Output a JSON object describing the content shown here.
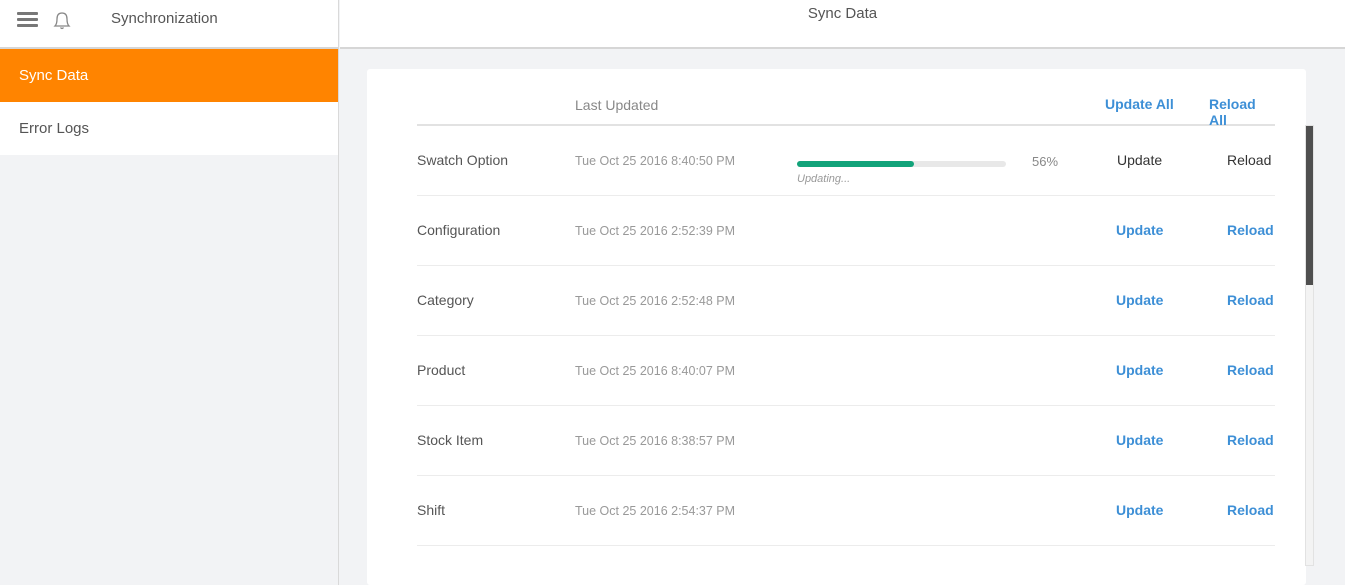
{
  "sidebar": {
    "title": "Synchronization",
    "icons": {
      "menu": "hamburger-menu-icon",
      "notifications": "bell-icon"
    },
    "items": [
      {
        "label": "Sync Data",
        "active": true
      },
      {
        "label": "Error Logs",
        "active": false
      }
    ]
  },
  "header": {
    "title": "Sync Data"
  },
  "table": {
    "column_last_updated": "Last Updated",
    "update_all_label": "Update All",
    "reload_all_label": "Reload All",
    "rows": [
      {
        "name": "Swatch Option",
        "last_updated": "Tue Oct 25 2016 8:40:50 PM",
        "update_label": "Update",
        "reload_label": "Reload",
        "syncing": true,
        "progress_percent": 56,
        "progress_text": "56%",
        "status_text": "Updating..."
      },
      {
        "name": "Configuration",
        "last_updated": "Tue Oct 25 2016 2:52:39 PM",
        "update_label": "Update",
        "reload_label": "Reload"
      },
      {
        "name": "Category",
        "last_updated": "Tue Oct 25 2016 2:52:48 PM",
        "update_label": "Update",
        "reload_label": "Reload"
      },
      {
        "name": "Product",
        "last_updated": "Tue Oct 25 2016 8:40:07 PM",
        "update_label": "Update",
        "reload_label": "Reload"
      },
      {
        "name": "Stock Item",
        "last_updated": "Tue Oct 25 2016 8:38:57 PM",
        "update_label": "Update",
        "reload_label": "Reload"
      },
      {
        "name": "Shift",
        "last_updated": "Tue Oct 25 2016 2:54:37 PM",
        "update_label": "Update",
        "reload_label": "Reload"
      }
    ]
  },
  "colors": {
    "accent": "#ff8400",
    "link": "#3d8fd6",
    "progress": "#12a37a"
  }
}
